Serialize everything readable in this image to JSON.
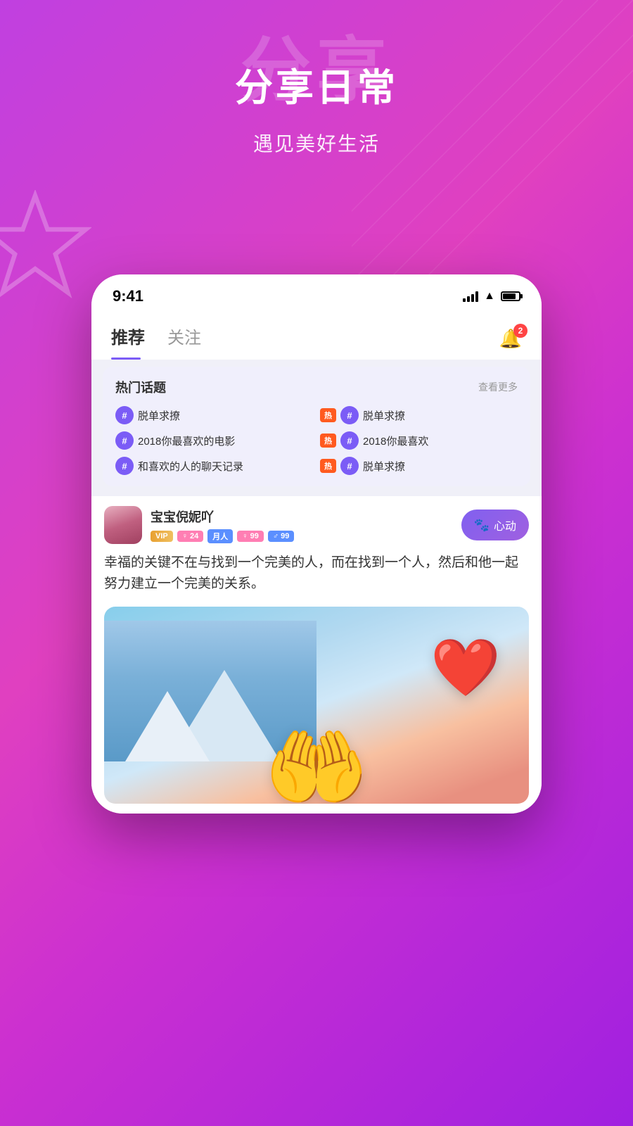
{
  "app": {
    "gradient_start": "#c040e0",
    "gradient_end": "#a020e0"
  },
  "hero": {
    "bg_text": "分享",
    "main_text": "分享日常",
    "sub_text": "遇见美好生活"
  },
  "status_bar": {
    "time": "9:41",
    "signal_label": "signal",
    "wifi_label": "wifi",
    "battery_label": "battery"
  },
  "tabs": {
    "active": "推荐",
    "items": [
      "推荐",
      "关注"
    ],
    "notification_count": "2"
  },
  "hot_topics": {
    "title": "热门话题",
    "more_label": "查看更多",
    "items": [
      {
        "text": "脱单求撩",
        "hot": false
      },
      {
        "text": "脱单求撩",
        "hot": true
      },
      {
        "text": "2018你最喜欢的电影",
        "hot": false
      },
      {
        "text": "2018你最喜欢",
        "hot": true
      },
      {
        "text": "和喜欢的人的聊天记录",
        "hot": false
      },
      {
        "text": "脱单求撩",
        "hot": true
      }
    ]
  },
  "post": {
    "username": "宝宝倪妮吖",
    "badges": {
      "vip": "VIP",
      "female": "♀ 24",
      "verified": "月人",
      "f99": "♀ 99",
      "m99": "♂ 99"
    },
    "heart_btn_label": "心动",
    "text": "幸福的关键不在与找到一个完美的人，而在找到一个人，然后和他一起努力建立一个完美的关系。"
  }
}
